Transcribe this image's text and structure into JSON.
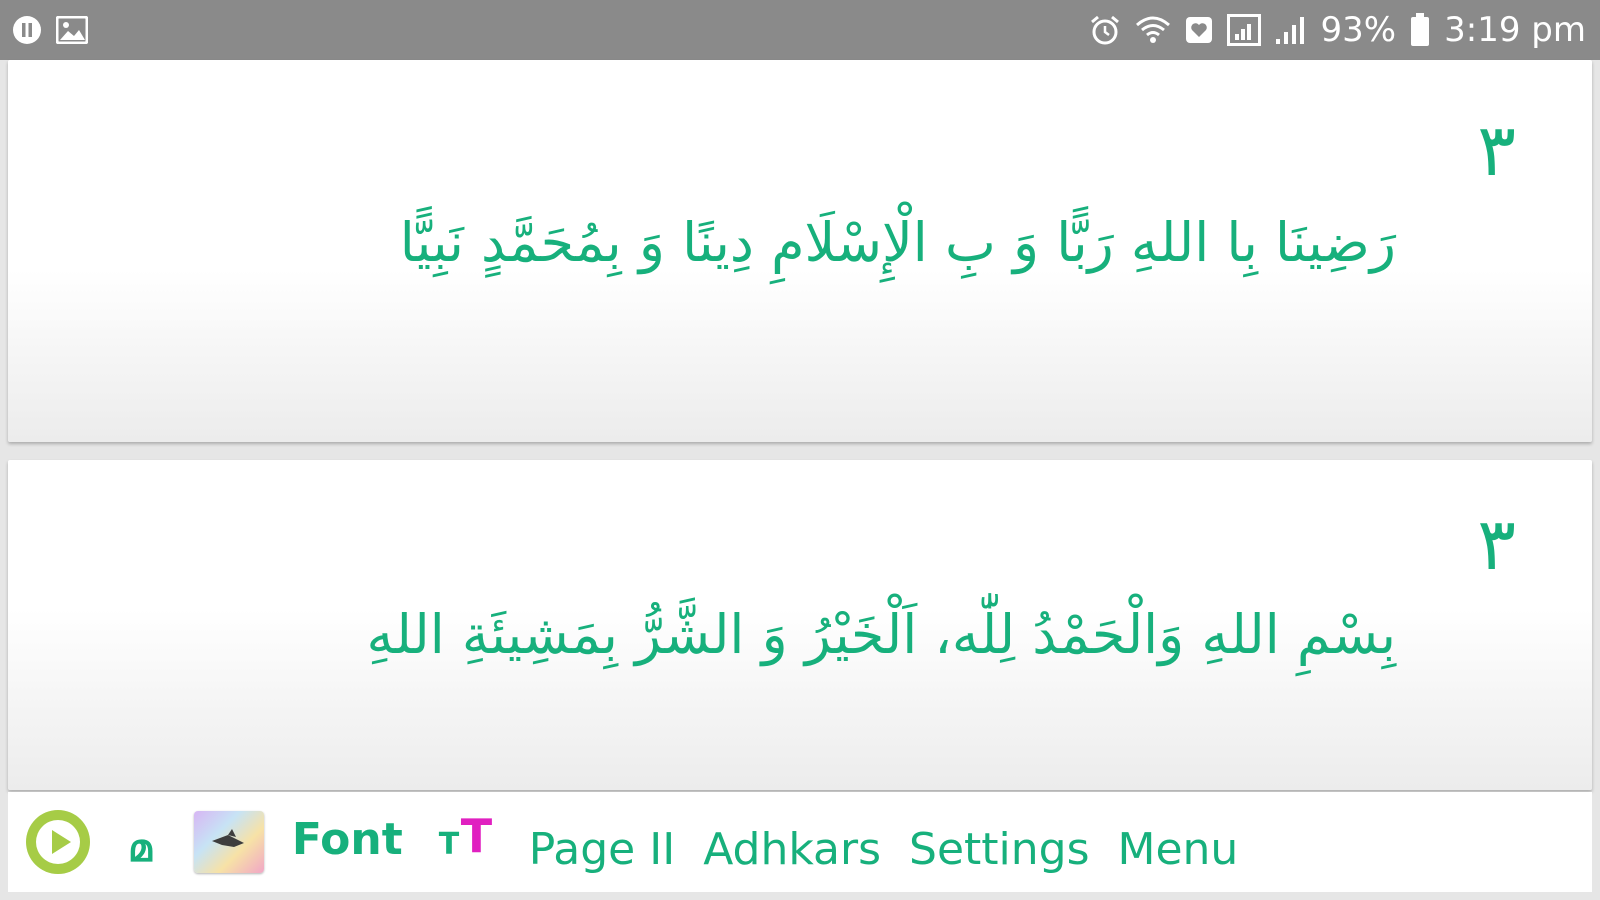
{
  "status_bar": {
    "left_icons": [
      "pause-circle-icon",
      "image-icon"
    ],
    "right_icons": [
      "alarm-icon",
      "wifi-icon",
      "heart-box-icon",
      "signal-box-icon",
      "signal-icon",
      "battery-icon"
    ],
    "battery": "93%",
    "time": "3:19 pm"
  },
  "cards": [
    {
      "count": "٣",
      "text": "رَضِينَا بِا اللهِ رَبًّا وَ بِ الْإِسْلَامِ دِينًا وَ بِمُحَمَّدٍ نَبِيًّا"
    },
    {
      "count": "٣",
      "text": "بِسْمِ اللهِ وَالْحَمْدُ لِلّٰه، اَلْخَيْرُ وَ الشَّرُّ بِمَشِيئَةِ اللهِ"
    }
  ],
  "toolbar": {
    "play_icon": "play-icon",
    "lang_glyph": "മ",
    "theme_icon": "theme-picker-icon",
    "font_label": "Font",
    "size_small": "T",
    "size_big": "T",
    "page_label": "Page II",
    "adhkars_label": "Adhkars",
    "settings_label": "Settings",
    "menu_label": "Menu"
  },
  "colors": {
    "accent": "#17b07c",
    "play": "#a6cc46",
    "size_big": "#e020c0",
    "status_bar": "#8a8a8a"
  }
}
